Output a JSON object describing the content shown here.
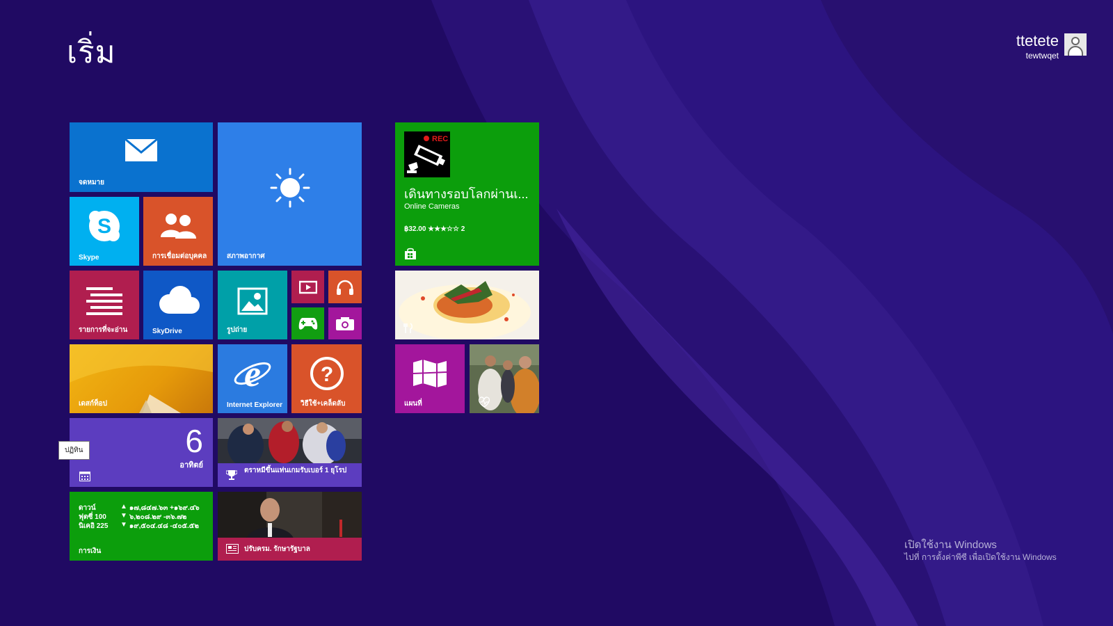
{
  "header": {
    "title": "เริ่ม"
  },
  "user": {
    "name": "ttetete",
    "account": "tewtwqet"
  },
  "tiles": {
    "mail": {
      "label": "จดหมาย",
      "color": "#0a72cf"
    },
    "weather": {
      "label": "สภาพอากาศ",
      "color": "#2e7fe8"
    },
    "skype": {
      "label": "Skype",
      "color": "#00b0f0"
    },
    "people": {
      "label": "การเชื่อมต่อบุคคล",
      "color": "#d9532a"
    },
    "reading": {
      "label": "รายการที่จะอ่าน",
      "color": "#b01e4f"
    },
    "skydrive": {
      "label": "SkyDrive",
      "color": "#0f58c6"
    },
    "photos": {
      "label": "รูปถ่าย",
      "color": "#00a0a8"
    },
    "video": {
      "color": "#b01e4f"
    },
    "music": {
      "color": "#d9532a"
    },
    "games": {
      "color": "#119e11"
    },
    "camera": {
      "color": "#a3169c"
    },
    "desktop": {
      "label": "เดสก์ท็อป"
    },
    "ie": {
      "label": "Internet Explorer",
      "color": "#2b7be0"
    },
    "help": {
      "label": "วิธีใช้+เคล็ดลับ",
      "color": "#d9532a"
    },
    "calendar": {
      "day_number": "6",
      "day_name": "อาทิตย์",
      "tooltip": "ปฏิทิน",
      "color": "#5c3dbf"
    },
    "sports": {
      "headline": "ตราหมีขึ้นแท่นเกมรับเบอร์ 1 ยุโรป",
      "color": "#5c3dbf"
    },
    "finance": {
      "label": "การเงิน",
      "color": "#0c9e0c",
      "rows": [
        {
          "name": "ดาวน์",
          "arrow": "▲",
          "value": "๑๗,๘๔๗.๖๓ +๑๖๙.๔๖"
        },
        {
          "name": "ฟุตซี่ 100",
          "arrow": "▼",
          "value": "๖,๒๐๘.๒๙ -๓๖.๗๒"
        },
        {
          "name": "นิเคอิ 225",
          "arrow": "▼",
          "value": "๑๙,๕๐๔.๔๘ -๔๐๕.๕๒"
        }
      ]
    },
    "news": {
      "headline": "ปรับครม. รักษารัฐบาล",
      "color": "#b01e4f"
    },
    "store": {
      "title": "เดินทางรอบโลกผ่านเ...",
      "subtitle": "Online Cameras",
      "price_rating": "฿32.00 ★★★☆☆ 2",
      "rec_text": "REC",
      "color": "#0c9e0c"
    },
    "maps": {
      "label": "แผนที่",
      "color": "#a3169c"
    }
  },
  "watermark": {
    "line1": "เปิดใช้งาน Windows",
    "line2": "ไปที่ การตั้งค่าพีซี เพื่อเปิดใช้งาน Windows"
  }
}
